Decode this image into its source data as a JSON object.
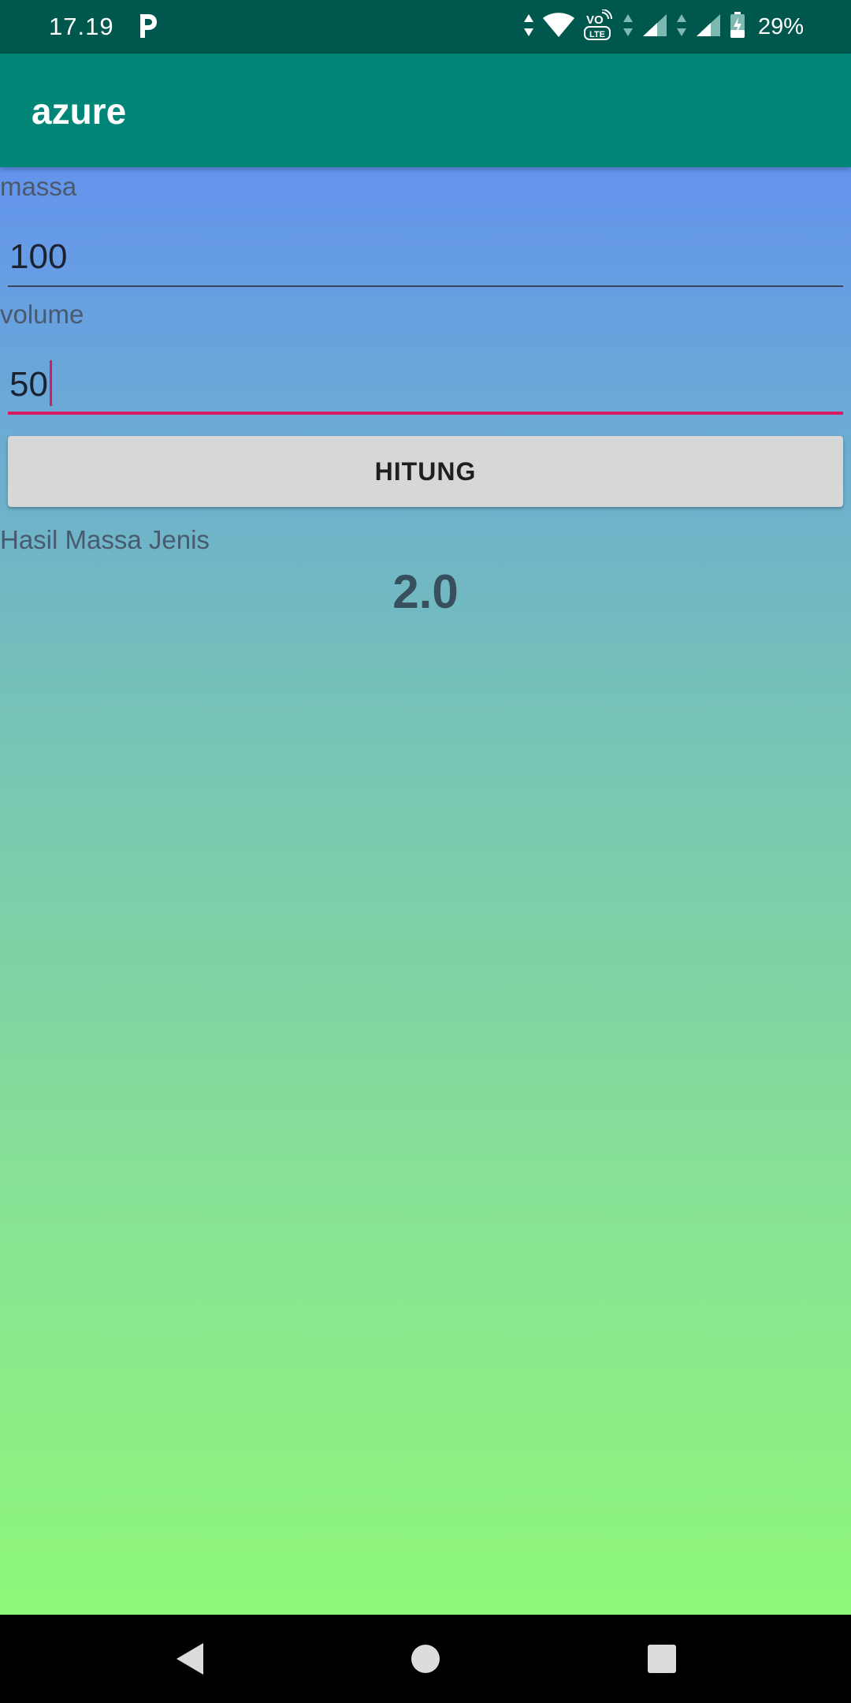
{
  "status_bar": {
    "time": "17.19",
    "battery_percent": "29%",
    "icons": [
      "parking-p-icon",
      "data-arrows-icon",
      "wifi-icon",
      "volte-icon",
      "signal-icon",
      "battery-charging-icon"
    ]
  },
  "app_bar": {
    "title": "azure"
  },
  "form": {
    "massa_label": "massa",
    "massa_value": "100",
    "volume_label": "volume",
    "volume_value": "50",
    "button_label": "HITUNG",
    "result_label": "Hasil Massa Jenis",
    "result_value": "2.0"
  },
  "colors": {
    "status_bar": "#00574d",
    "app_bar": "#008577",
    "accent": "#d81b60",
    "gradient_top": "#6394ee",
    "gradient_bottom": "#8ff87a"
  },
  "nav_bar": {
    "buttons": [
      "back-icon",
      "home-icon",
      "recents-icon"
    ]
  }
}
